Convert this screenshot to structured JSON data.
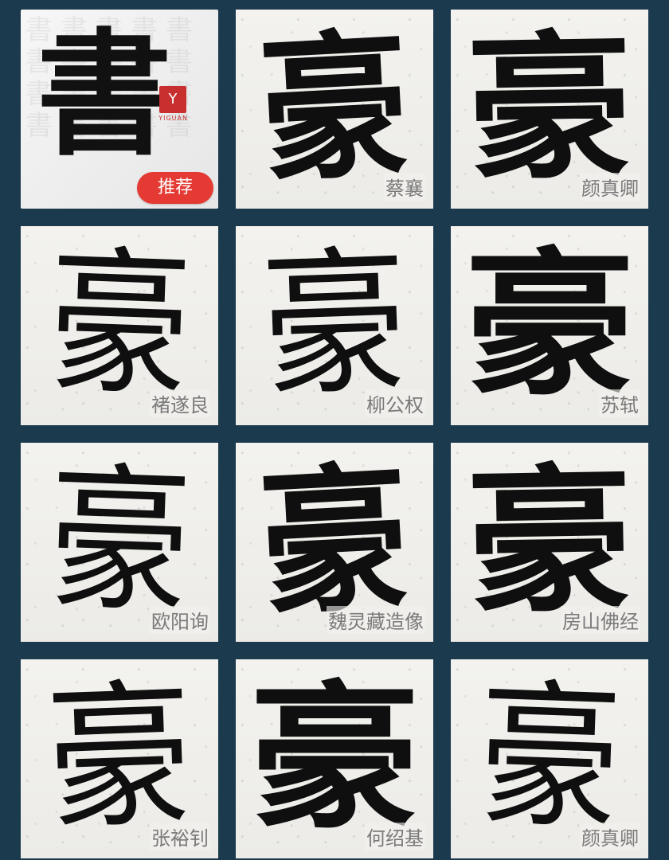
{
  "recommend": {
    "main_char": "書",
    "seal_text": "Y",
    "seal_sub": "YIGUAN",
    "badge": "推荐",
    "bg_chars": "書書書書書書書書書書書書書書書書書書書書"
  },
  "tiles": [
    {
      "char": "豪",
      "artist": "蔡襄"
    },
    {
      "char": "豪",
      "artist": "颜真卿"
    },
    {
      "char": "豪",
      "artist": "褚遂良"
    },
    {
      "char": "豪",
      "artist": "柳公权"
    },
    {
      "char": "豪",
      "artist": "苏轼"
    },
    {
      "char": "豪",
      "artist": "欧阳询"
    },
    {
      "char": "豪",
      "artist": "魏灵藏造像"
    },
    {
      "char": "豪",
      "artist": "房山佛经"
    },
    {
      "char": "豪",
      "artist": "张裕钊"
    },
    {
      "char": "豪",
      "artist": "何绍基"
    },
    {
      "char": "豪",
      "artist": "颜真卿"
    }
  ],
  "colors": {
    "background": "#1c3a4e",
    "badge": "#e43a33",
    "seal": "#c82f2f"
  }
}
